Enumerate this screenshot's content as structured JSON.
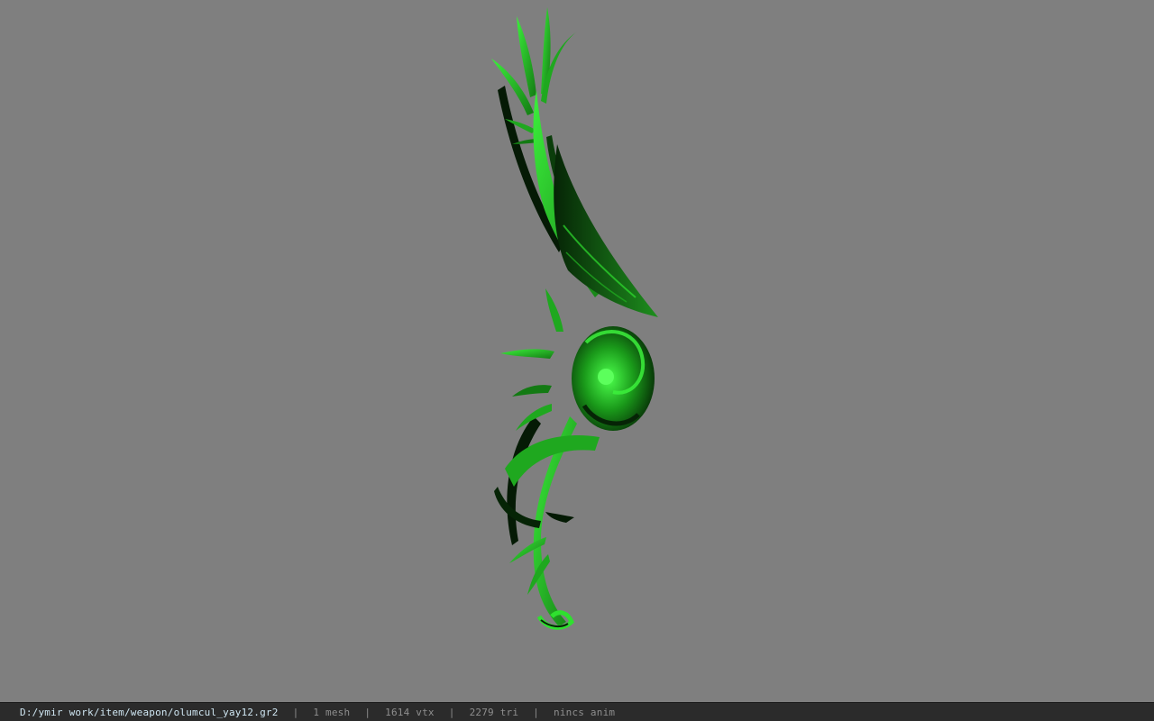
{
  "viewer": {
    "background_color": "#7f7f7f",
    "model_colors": {
      "bright": "#2fe02f",
      "mid": "#1fa81f",
      "dark": "#0b3d0b",
      "shadow": "#041a04"
    }
  },
  "status_bar": {
    "file_path": "D:/ymir work/item/weapon/olumcul_yay12.gr2",
    "separator": "|",
    "mesh_count": "1 mesh",
    "vertex_count": "1614 vtx",
    "triangle_count": "2279 tri",
    "animation": "nincs anim"
  }
}
